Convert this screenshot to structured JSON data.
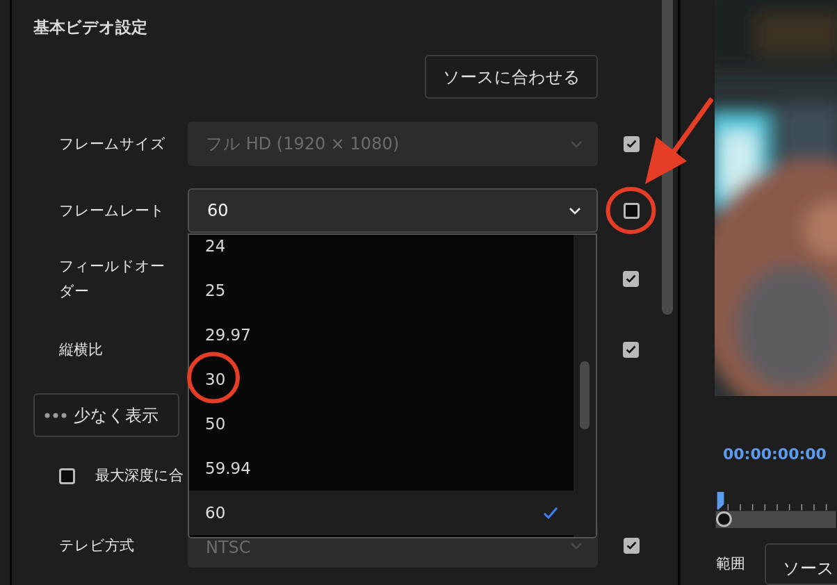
{
  "heading": "基本ビデオ設定",
  "match_source_button": "ソースに合わせる",
  "settings": [
    {
      "label": "フレームサイズ",
      "value": "フル HD (1920 × 1080)",
      "disabled": true,
      "checked": true
    },
    {
      "label": "フレームレート",
      "value": "60",
      "disabled": false,
      "checked": false
    },
    {
      "label": "フィールドオーダー",
      "checked": true
    },
    {
      "label": "縦横比",
      "checked": true
    }
  ],
  "less_button": "少なく表示",
  "max_depth": {
    "label": "最大深度に合",
    "checked": false
  },
  "tv_system": {
    "label": "テレビ方式",
    "value": "NTSC",
    "disabled": true,
    "checked": true
  },
  "dropdown": {
    "options": [
      {
        "label": "24",
        "selected": false
      },
      {
        "label": "25",
        "selected": false
      },
      {
        "label": "29.97",
        "selected": false
      },
      {
        "label": "30",
        "selected": false
      },
      {
        "label": "50",
        "selected": false
      },
      {
        "label": "59.94",
        "selected": false
      },
      {
        "label": "60",
        "selected": true
      }
    ]
  },
  "timecode": "00:00:00:00",
  "range": {
    "label": "範囲",
    "value": "ソース"
  }
}
